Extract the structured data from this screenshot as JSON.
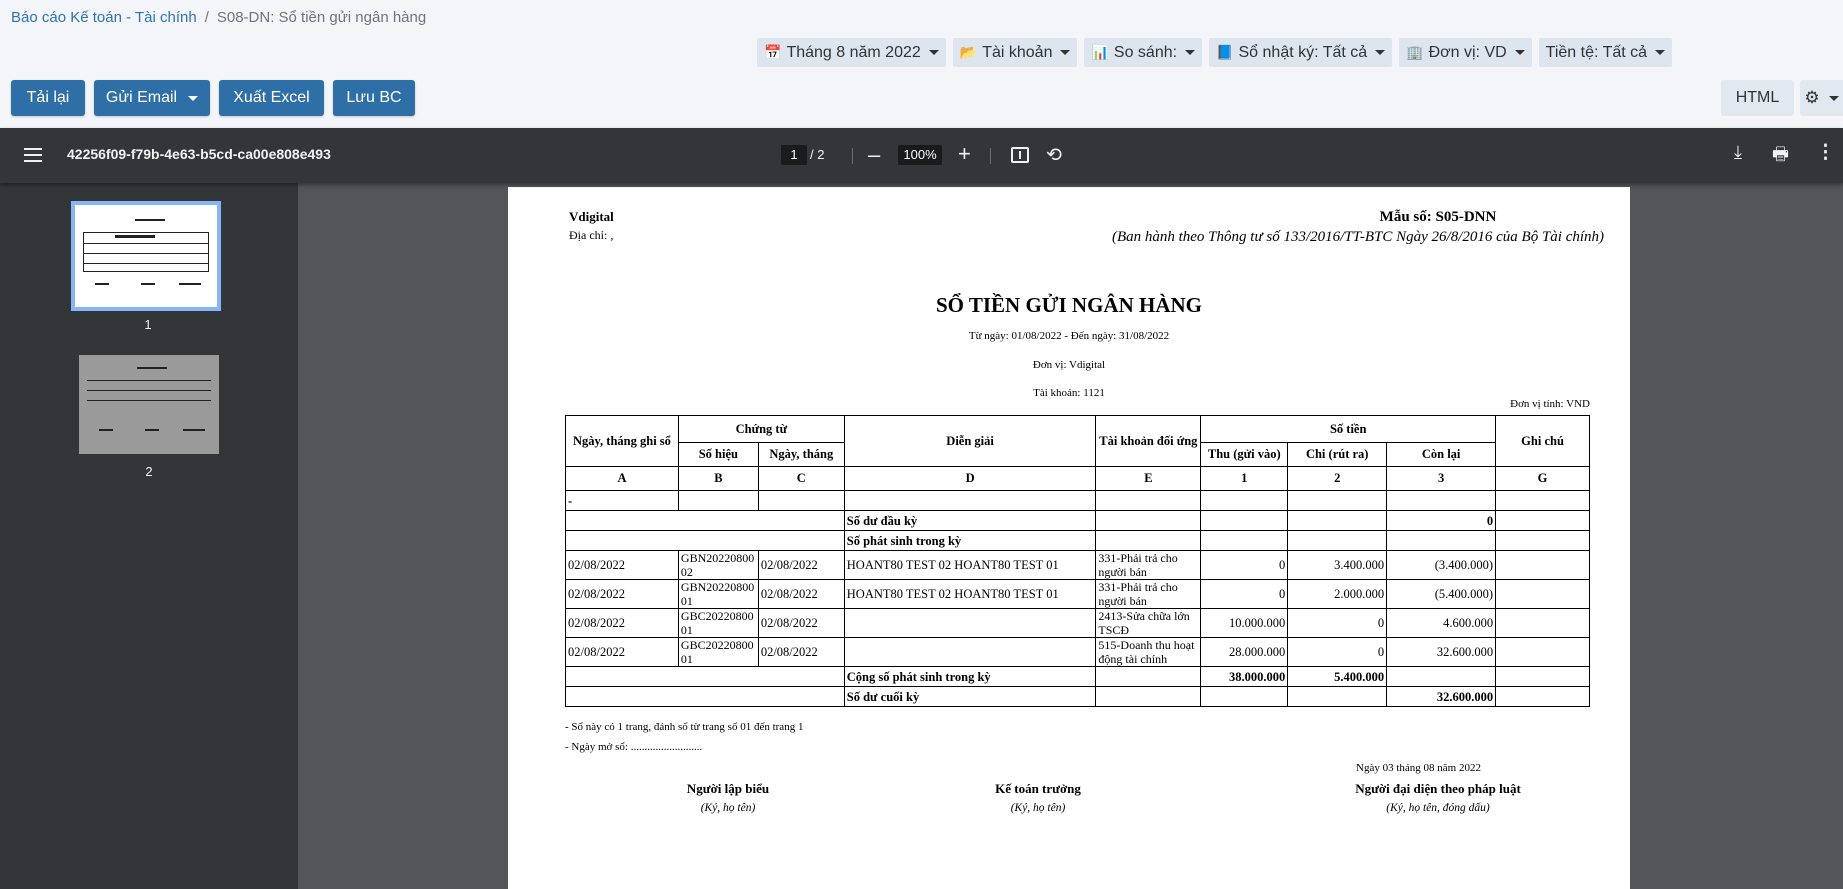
{
  "breadcrumb": {
    "root": "Báo cáo Kế toán - Tài chính",
    "separator": "/",
    "current": "S08-DN: Sổ tiền gửi ngân hàng"
  },
  "filters": [
    {
      "icon": "calendar-icon",
      "label": "Tháng 8 năm 2022"
    },
    {
      "icon": "folder-icon",
      "label": "Tài khoản"
    },
    {
      "icon": "chart-icon",
      "label": "So sánh:"
    },
    {
      "icon": "book-icon",
      "label": "Sổ nhật ký: Tất cả"
    },
    {
      "icon": "building-icon",
      "label": "Đơn vị: VD"
    },
    {
      "icon": "",
      "label": "Tiền tệ: Tất cả"
    }
  ],
  "actions": {
    "reload": "Tải lại",
    "send_email": "Gửi Email",
    "export_excel": "Xuất Excel",
    "save_report": "Lưu BC",
    "html": "HTML"
  },
  "viewer": {
    "doc_id": "42256f09-f79b-4e63-b5cd-ca00e808e493",
    "page_current": "1",
    "page_total": "/ 2",
    "zoom": "100%"
  },
  "thumbnails": [
    "1",
    "2"
  ],
  "report": {
    "company": "Vdigital",
    "address": "Địa chỉ: ,",
    "form_code": "Mẫu số: S05-DNN",
    "form_note": "(Ban hành theo Thông tư số 133/2016/TT-BTC Ngày 26/8/2016 của Bộ Tài chính)",
    "title": "SỔ TIỀN GỬI NGÂN HÀNG",
    "period": "Từ ngày: 01/08/2022 - Đến ngày: 31/08/2022",
    "unit": "Đơn vị: Vdigital",
    "account": "Tài khoản: 1121",
    "currency_note": "Đơn vị tính: VND",
    "headers": {
      "date": "Ngày, tháng ghi sổ",
      "voucher": "Chứng từ",
      "voucher_no": "Số hiệu",
      "voucher_date": "Ngày, tháng",
      "description": "Diễn giải",
      "contra": "Tài khoản đối ứng",
      "amount": "Số tiền",
      "debit": "Thu (gửi vào)",
      "credit": "Chi (rút ra)",
      "balance": "Còn lại",
      "note": "Ghi chú"
    },
    "codes": [
      "A",
      "B",
      "C",
      "D",
      "E",
      "1",
      "2",
      "3",
      "G"
    ],
    "dash_row": "-",
    "opening_label": "Số dư đầu kỳ",
    "opening_balance": "0",
    "period_label": "Số phát sinh trong kỳ",
    "rows": [
      {
        "date": "02/08/2022",
        "no": "GBN2022080002",
        "vdate": "02/08/2022",
        "desc": "HOANT80 TEST 02 HOANT80 TEST 01",
        "contra": "331-Phải trả cho người bán",
        "debit": "0",
        "credit": "3.400.000",
        "balance": "(3.400.000)"
      },
      {
        "date": "02/08/2022",
        "no": "GBN2022080001",
        "vdate": "02/08/2022",
        "desc": "HOANT80 TEST 02 HOANT80 TEST 01",
        "contra": "331-Phải trả cho người bán",
        "debit": "0",
        "credit": "2.000.000",
        "balance": "(5.400.000)"
      },
      {
        "date": "02/08/2022",
        "no": "GBC2022080001",
        "vdate": "02/08/2022",
        "desc": "",
        "contra": "2413-Sửa chữa lớn TSCĐ",
        "debit": "10.000.000",
        "credit": "0",
        "balance": "4.600.000"
      },
      {
        "date": "02/08/2022",
        "no": "GBC2022080001",
        "vdate": "02/08/2022",
        "desc": "",
        "contra": "515-Doanh thu hoạt động tài chính",
        "debit": "28.000.000",
        "credit": "0",
        "balance": "32.600.000"
      }
    ],
    "total_label": "Cộng số phát sinh trong kỳ",
    "total_debit": "38.000.000",
    "total_credit": "5.400.000",
    "closing_label": "Số dư cuối kỳ",
    "closing_balance": "32.600.000",
    "footnote1": "- Sổ này có 1 trang, đánh số từ trang số 01 đến trang 1",
    "footnote2": "- Ngày mở sổ: ..........................",
    "sign_date": "Ngày 03 tháng 08 năm 2022",
    "signers": [
      {
        "role": "Người lập biểu",
        "hint": "(Ký, họ tên)"
      },
      {
        "role": "Kế toán trưởng",
        "hint": "(Ký, họ tên)"
      },
      {
        "role": "Người đại diện theo pháp luật",
        "hint": "(Ký, họ tên, đóng dấu)"
      }
    ]
  }
}
